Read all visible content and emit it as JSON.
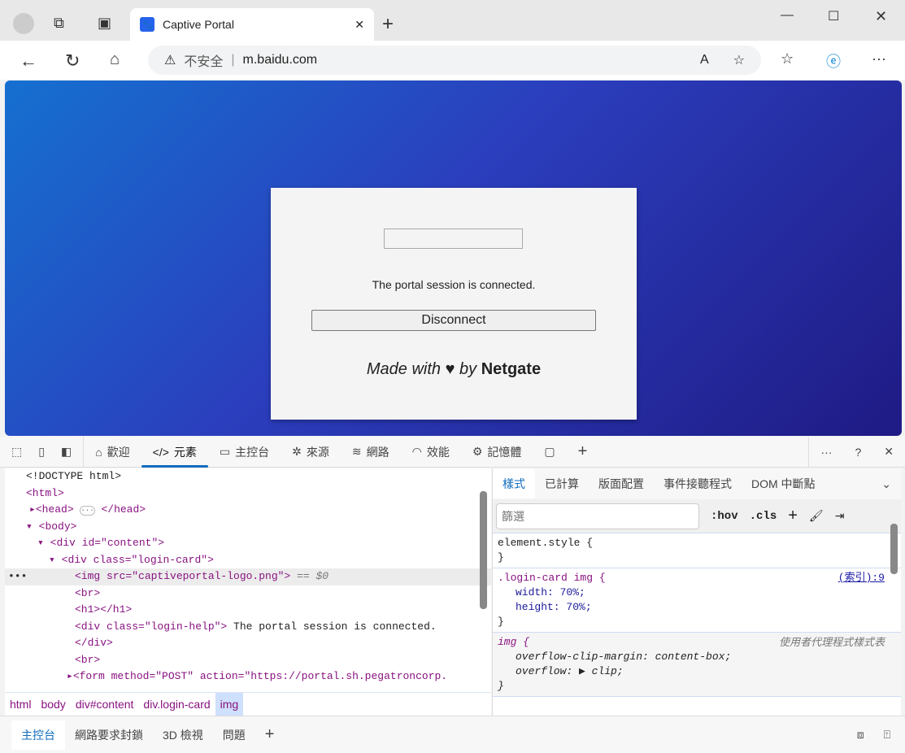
{
  "browser": {
    "tab_title": "Captive Portal",
    "security_label": "不安全",
    "url": "m.baidu.com"
  },
  "page": {
    "status_text": "The portal session is connected.",
    "disconnect_label": "Disconnect",
    "footer_prefix": "Made with",
    "footer_heart": "♥",
    "footer_by": "by",
    "footer_brand": "Netgate"
  },
  "devtools": {
    "tabs": [
      {
        "label": "歡迎",
        "icon": "home-icon"
      },
      {
        "label": "元素",
        "icon": "code-icon"
      },
      {
        "label": "主控台",
        "icon": "console-icon"
      },
      {
        "label": "來源",
        "icon": "bug-icon"
      },
      {
        "label": "網路",
        "icon": "wifi-icon"
      },
      {
        "label": "效能",
        "icon": "gauge-icon"
      },
      {
        "label": "記憶體",
        "icon": "chip-icon"
      }
    ],
    "dom": {
      "doctype": "<!DOCTYPE html>",
      "html": "<html>",
      "head": "<head>",
      "head_close": "</head>",
      "body": "<body>",
      "div_content": "<div id=\"content\">",
      "div_card": "<div class=\"login-card\">",
      "img_tag": "<img src=\"captiveportal-logo.png\">",
      "img_suffix": "== $0",
      "br": "<br>",
      "h1": "<h1></h1>",
      "login_help_open": "<div class=\"login-help\">",
      "login_help_text": " The portal session is connected.",
      "div_close": "</div>",
      "form": "<form method=\"POST\" action=\"https://portal.sh.pegatroncorp."
    },
    "breadcrumbs": [
      "html",
      "body",
      "div#content",
      "div.login-card",
      "img"
    ],
    "styles_tabs": [
      "樣式",
      "已計算",
      "版面配置",
      "事件接聽程式",
      "DOM 中斷點"
    ],
    "filter_placeholder": "篩選",
    "hov": ":hov",
    "cls": ".cls",
    "rules": {
      "element_style": "element.style {",
      "close": "}",
      "login_selector": ".login-card img {",
      "login_source": "(索引):9",
      "width": "width: 70%;",
      "height": "height: 70%;",
      "ua_selector": "img {",
      "ua_source": "使用者代理程式樣式表",
      "ocm": "overflow-clip-margin: content-box;",
      "overflow": "overflow: ▶ clip;"
    },
    "drawer_tabs": [
      "主控台",
      "網路要求封鎖",
      "3D 檢視",
      "問題"
    ]
  }
}
